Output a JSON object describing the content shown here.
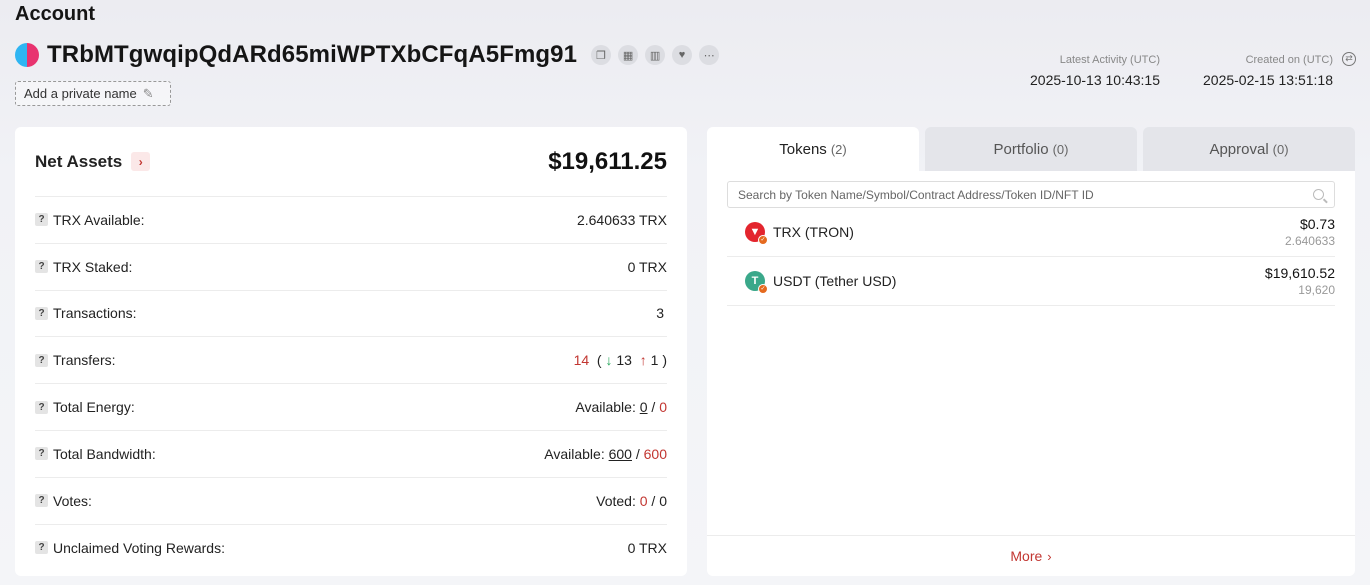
{
  "page": {
    "title": "Account"
  },
  "account": {
    "address": "TRbMTgwqipQdARd65miWPTXbCFqA5Fmg91",
    "private_name_label": "Add a private name",
    "latest_activity_label": "Latest Activity (UTC)",
    "latest_activity_value": "2025-10-13 10:43:15",
    "created_label": "Created on (UTC)",
    "created_value": "2025-02-15 13:51:18"
  },
  "net_assets": {
    "title": "Net Assets",
    "value": "$19,611.25"
  },
  "rows": {
    "trx_available": {
      "label": "TRX Available:",
      "value": "2.640633 TRX"
    },
    "trx_staked": {
      "label": "TRX Staked:",
      "value": "0 TRX"
    },
    "transactions": {
      "label": "Transactions:",
      "value": "3"
    },
    "transfers": {
      "label": "Transfers:",
      "total": "14",
      "in": "13",
      "out": "1"
    },
    "total_energy": {
      "label": "Total Energy:",
      "prefix": "Available:",
      "available": "0",
      "total": "0"
    },
    "total_bandwidth": {
      "label": "Total Bandwidth:",
      "prefix": "Available:",
      "available": "600",
      "total": "600"
    },
    "votes": {
      "label": "Votes:",
      "prefix": "Voted:",
      "voted": "0",
      "total": "0"
    },
    "unclaimed": {
      "label": "Unclaimed Voting Rewards:",
      "value": "0 TRX"
    }
  },
  "tabs": [
    {
      "label": "Tokens",
      "count": "(2)"
    },
    {
      "label": "Portfolio",
      "count": "(0)"
    },
    {
      "label": "Approval",
      "count": "(0)"
    }
  ],
  "search": {
    "placeholder": "Search by Token Name/Symbol/Contract Address/Token ID/NFT ID"
  },
  "tokens": [
    {
      "name": "TRX (TRON)",
      "usd": "$0.73",
      "amount": "2.640633",
      "icon": "tron-icon"
    },
    {
      "name": "USDT (Tether USD)",
      "usd": "$19,610.52",
      "amount": "19,620",
      "icon": "tether-icon"
    }
  ],
  "more_label": "More",
  "colors": {
    "accent_red": "#c23631",
    "green": "#26a65b"
  }
}
